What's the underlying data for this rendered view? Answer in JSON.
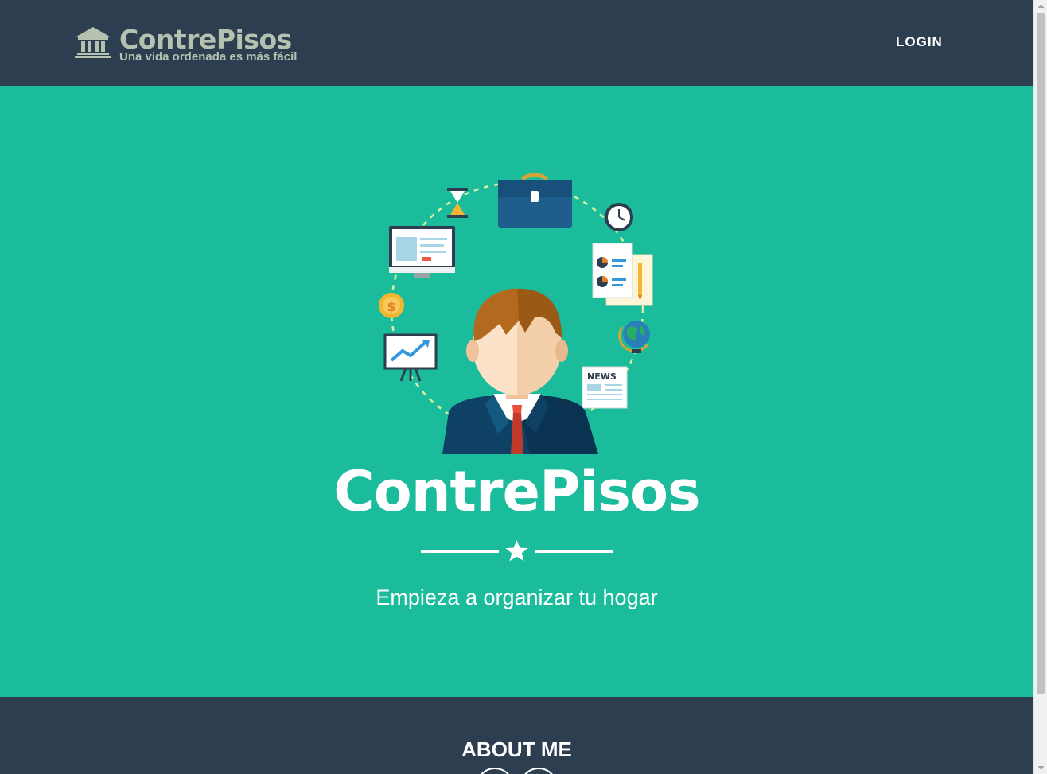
{
  "navbar": {
    "brand_title": "ContrePisos",
    "brand_subtitle": "Una vida ordenada es más fácil",
    "brand_icon": "bank-building-icon",
    "login_label": "LOGIN"
  },
  "masthead": {
    "illustration": "businessman-avatar-with-office-icons",
    "title": "ContrePisos",
    "divider_icon": "star-icon",
    "subtitle": "Empieza a organizar tu hogar"
  },
  "about": {
    "title": "ABOUT ME"
  },
  "colors": {
    "navbar_bg": "#2c3e50",
    "masthead_bg": "#1abc9c",
    "brand_text": "#b6c2b0",
    "text_light": "#ffffff"
  }
}
